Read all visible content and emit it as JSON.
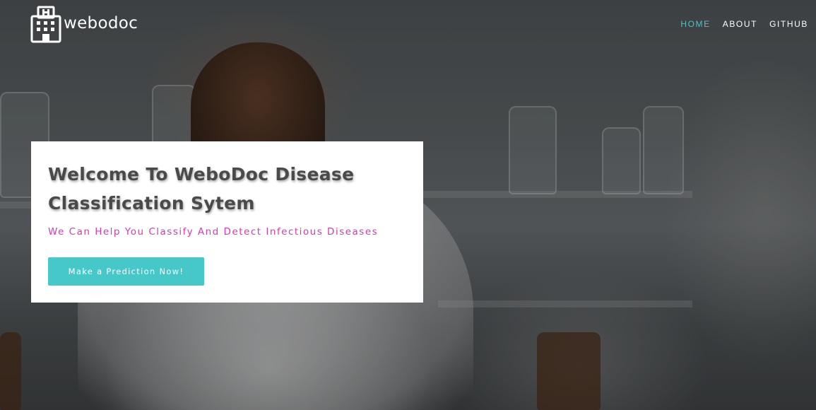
{
  "brand": {
    "name": "webodoc",
    "icon": "hospital-building-icon"
  },
  "nav": {
    "items": [
      {
        "label": "HOME",
        "active": true
      },
      {
        "label": "ABOUT",
        "active": false
      },
      {
        "label": "GITHUB",
        "active": false
      }
    ]
  },
  "hero": {
    "title": "Welcome To WeboDoc Disease Classification Sytem",
    "subtitle": "We Can Help You Classify And Detect Infectious Diseases",
    "cta_label": "Make a Prediction Now!"
  },
  "colors": {
    "accent": "#46c8c9",
    "subtitle": "#d63ab0",
    "title": "#4a4a4a"
  }
}
